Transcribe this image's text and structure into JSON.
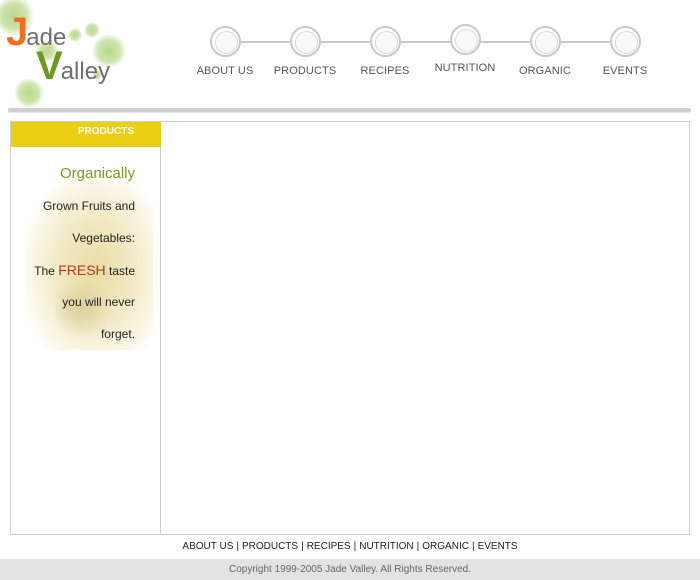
{
  "logo": {
    "first_initial": "J",
    "first_rest": "ade",
    "second_initial": "V",
    "second_rest": "alley"
  },
  "top_nav": [
    {
      "label": "ABOUT US"
    },
    {
      "label": "PRODUCTS"
    },
    {
      "label": "RECIPES"
    },
    {
      "label": "NUTRITION"
    },
    {
      "label": "ORGANIC"
    },
    {
      "label": "EVENTS"
    }
  ],
  "sidebar": {
    "tab_label": "PRODUCTS",
    "promo": {
      "line1": "Organically",
      "line2": "Grown Fruits and",
      "line3": "Vegetables:",
      "line4_pre": "The ",
      "line4_fresh": "FRESH",
      "line4_post": " taste",
      "line5": "you will never",
      "line6": "forget."
    }
  },
  "footer_nav": [
    {
      "label": "ABOUT US"
    },
    {
      "label": "PRODUCTS"
    },
    {
      "label": "RECIPES"
    },
    {
      "label": "NUTRITION"
    },
    {
      "label": "ORGANIC"
    },
    {
      "label": "EVENTS"
    }
  ],
  "footer_separator": "|",
  "copyright": "Copyright 1999-2005 Jade Valley. All Rights Reserved.",
  "colors": {
    "accent_yellow": "#ecce12",
    "logo_orange": "#ef6f1e",
    "logo_green": "#6a9a22",
    "fresh_red": "#b5381f"
  }
}
